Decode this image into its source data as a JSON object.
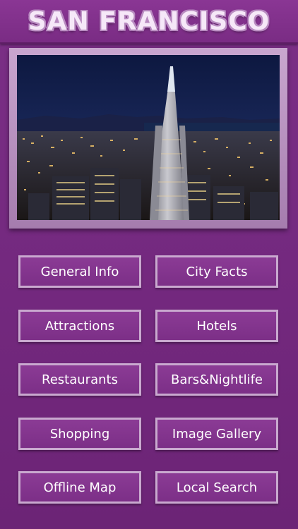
{
  "app": {
    "title": "SAN FRANCISCO"
  },
  "hero_image": {
    "subject": "San Francisco skyline at night"
  },
  "menu": {
    "general_info": "General Info",
    "city_facts": "City Facts",
    "attractions": "Attractions",
    "hotels": "Hotels",
    "restaurants": "Restaurants",
    "bars_nightlife": "Bars&Nightlife",
    "shopping": "Shopping",
    "image_gallery": "Image Gallery",
    "offline_map": "Offline Map",
    "local_search": "Local Search"
  },
  "colors": {
    "background": "#74297f",
    "header": "#8a3694",
    "button_fill": "#8b3b95",
    "button_border": "#c9a9cf",
    "frame": "#c9a6cf"
  }
}
